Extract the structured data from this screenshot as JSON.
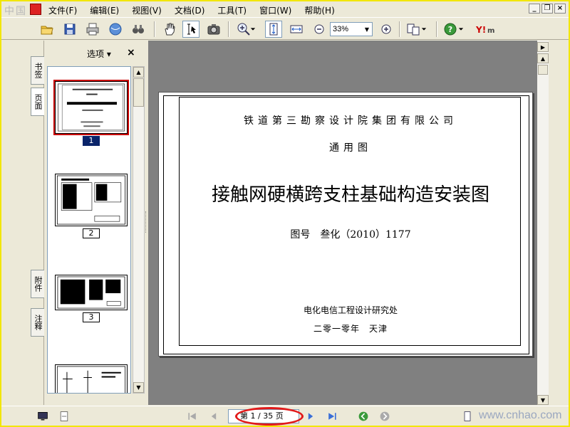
{
  "menubar": {
    "site_logo": "中国",
    "items": [
      "文件(F)",
      "编辑(E)",
      "视图(V)",
      "文档(D)",
      "工具(T)",
      "窗口(W)",
      "帮助(H)"
    ],
    "window_controls": [
      "_",
      "❐",
      "×"
    ]
  },
  "toolbar": {
    "zoom_value": "33%"
  },
  "tabs": {
    "bookmarks": "书签",
    "pages": "页面",
    "attachments": "附件",
    "comments": "注释"
  },
  "panel": {
    "options_label": "选项 ▾",
    "close_label": "×",
    "thumbnails": [
      {
        "label": "1",
        "selected": true
      },
      {
        "label": "2",
        "selected": false
      },
      {
        "label": "3",
        "selected": false
      }
    ]
  },
  "document": {
    "company": "铁道第三勘察设计院集团有限公司",
    "category": "通用图",
    "title": "接触网硬横跨支柱基础构造安装图",
    "drawing_number": "图号　叁化（2010）1177",
    "institute": "电化电信工程设计研究处",
    "date": "二零一零年　天津"
  },
  "statusbar": {
    "page_indicator": "第 1 / 35 页",
    "watermark": "www.cnhao.com"
  },
  "colors": {
    "frame": "#f2e600",
    "highlight_oval": "#e21a1a",
    "doc_background": "#808080",
    "selection": "#0a246a"
  }
}
